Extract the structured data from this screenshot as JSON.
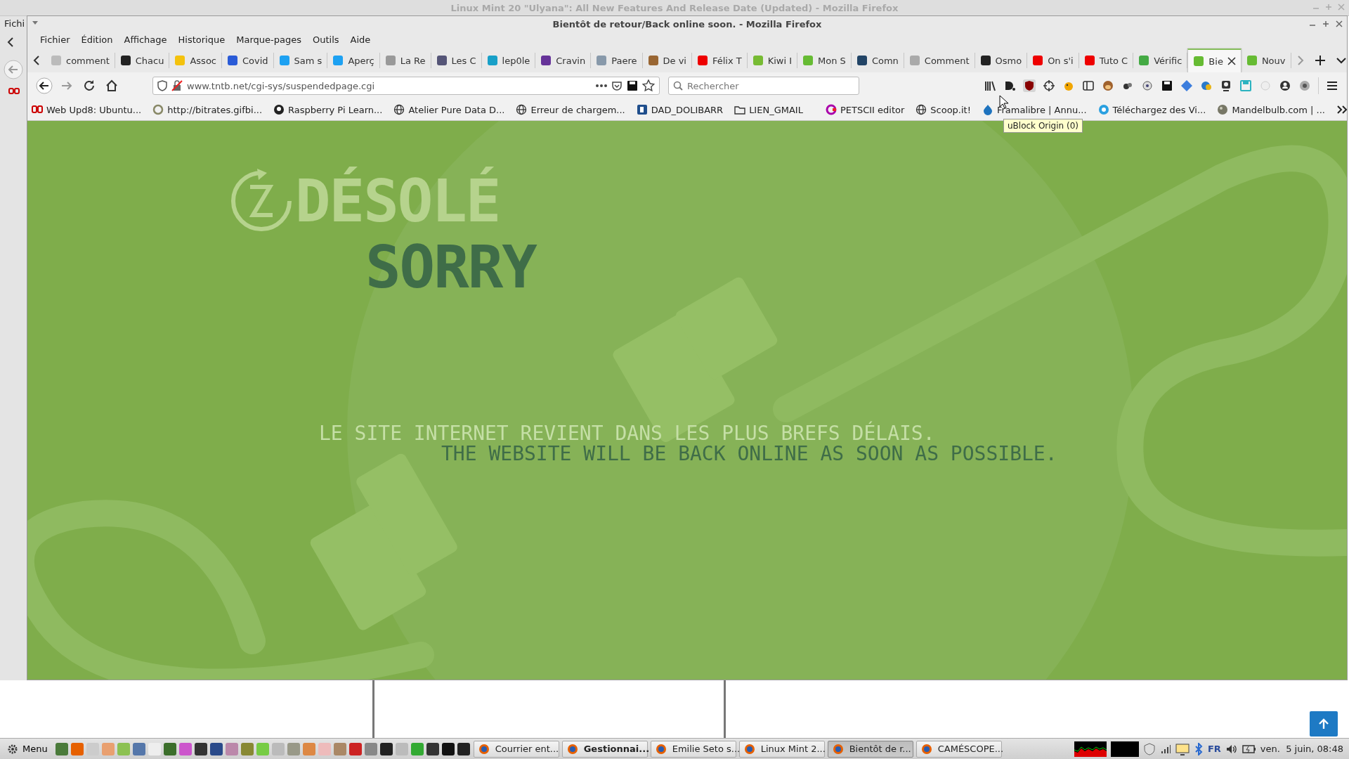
{
  "background_window": {
    "title": "Linux Mint 20 \"Ulyana\": All New Features And Release Date (Updated) - Mozilla Firefox",
    "menu_fragment": "Fichi"
  },
  "window": {
    "title": "Bientôt de retour/Back online soon. - Mozilla Firefox"
  },
  "menu": [
    "Fichier",
    "Édition",
    "Affichage",
    "Historique",
    "Marque-pages",
    "Outils",
    "Aide"
  ],
  "tabs": [
    {
      "label": "comment",
      "selected": false
    },
    {
      "label": "Chacu",
      "selected": false
    },
    {
      "label": "Assoc",
      "selected": false
    },
    {
      "label": "Covid",
      "selected": false
    },
    {
      "label": "Sam s",
      "selected": false
    },
    {
      "label": "Aperç",
      "selected": false
    },
    {
      "label": "La Re",
      "selected": false
    },
    {
      "label": "Les C",
      "selected": false
    },
    {
      "label": "lep0le",
      "selected": false
    },
    {
      "label": "Cravin",
      "selected": false
    },
    {
      "label": "Paere",
      "selected": false
    },
    {
      "label": "De vi",
      "selected": false
    },
    {
      "label": "Félix T",
      "selected": false
    },
    {
      "label": "Kiwi I",
      "selected": false
    },
    {
      "label": "Mon S",
      "selected": false
    },
    {
      "label": "Comn",
      "selected": false
    },
    {
      "label": "Comment",
      "selected": false
    },
    {
      "label": "Osmo",
      "selected": false
    },
    {
      "label": "On s'i",
      "selected": false
    },
    {
      "label": "Tuto C",
      "selected": false
    },
    {
      "label": "Vérific",
      "selected": false
    },
    {
      "label": "Bie",
      "selected": true
    },
    {
      "label": "Nouv",
      "selected": false
    }
  ],
  "address_bar": {
    "url": "www.tntb.net/cgi-sys/suspendedpage.cgi"
  },
  "search": {
    "placeholder": "Rechercher"
  },
  "bookmarks": [
    "Web Upd8: Ubuntu...",
    "http://bitrates.gifbi...",
    "Raspberry Pi Learn...",
    "Atelier Pure Data D...",
    "Erreur de chargem...",
    "DAD_DOLIBARR",
    "LIEN_GMAIL",
    "PETSCII editor",
    "Scoop.it!",
    "Framalibre | Annu...",
    "Téléchargez des Vi...",
    "Mandelbulb.com | ..."
  ],
  "tooltip": "uBlock Origin (0)",
  "page": {
    "heading_fr": "DÉSOLÉ",
    "heading_en": "SORRY",
    "message_fr": "LE SITE INTERNET REVIENT DANS LES PLUS BREFS DÉLAIS.",
    "message_en": "THE WEBSITE WILL BE BACK ONLINE AS SOON AS POSSIBLE."
  },
  "taskbar": {
    "menu_label": "Menu",
    "windows": [
      {
        "label": "Courrier ent...",
        "selected": false,
        "attention": false
      },
      {
        "label": "Gestionnai...",
        "selected": false,
        "attention": true
      },
      {
        "label": "Emilie Seto s...",
        "selected": false,
        "attention": false
      },
      {
        "label": "Linux Mint 2...",
        "selected": false,
        "attention": false
      },
      {
        "label": "Bientôt de r...",
        "selected": true,
        "attention": false
      },
      {
        "label": "CAMÉSCOPE...",
        "selected": false,
        "attention": false
      }
    ],
    "keyboard_layout": "FR",
    "clock": "ven.  5 juin, 08:48"
  }
}
